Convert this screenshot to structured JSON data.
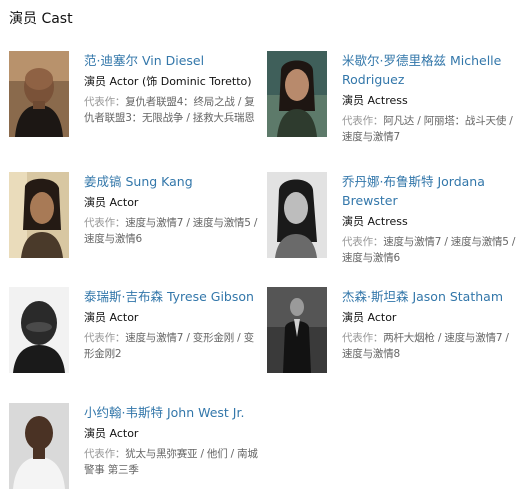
{
  "section": {
    "title": "演员 Cast"
  },
  "cast": [
    {
      "name": "范·迪塞尔 Vin Diesel",
      "role": "演员 Actor (饰 Dominic Toretto)",
      "works_label": "代表作：",
      "works": "复仇者联盟4：终局之战 / 复仇者联盟3：无限战争 / 拯救大兵瑞恩"
    },
    {
      "name": "米歇尔·罗德里格兹 Michelle Rodriguez",
      "role": "演员 Actress",
      "works_label": "代表作：",
      "works": "阿凡达 / 阿丽塔：战斗天使 / 速度与激情7"
    },
    {
      "name": "姜成镐 Sung Kang",
      "role": "演员 Actor",
      "works_label": "代表作：",
      "works": "速度与激情7 / 速度与激情5 / 速度与激情6"
    },
    {
      "name": "乔丹娜·布鲁斯特 Jordana Brewster",
      "role": "演员 Actress",
      "works_label": "代表作：",
      "works": "速度与激情7 / 速度与激情5 / 速度与激情6"
    },
    {
      "name": "泰瑞斯·吉布森 Tyrese Gibson",
      "role": "演员 Actor",
      "works_label": "代表作：",
      "works": "速度与激情7 / 变形金刚 / 变形金刚2"
    },
    {
      "name": "杰森·斯坦森 Jason Statham",
      "role": "演员 Actor",
      "works_label": "代表作：",
      "works": "两杆大烟枪 / 速度与激情7 / 速度与激情8"
    },
    {
      "name": "小约翰·韦斯特 John West Jr.",
      "role": "演员 Actor",
      "works_label": "代表作：",
      "works": "犹太与黑弥赛亚 / 他们 / 南城警事 第三季"
    }
  ]
}
